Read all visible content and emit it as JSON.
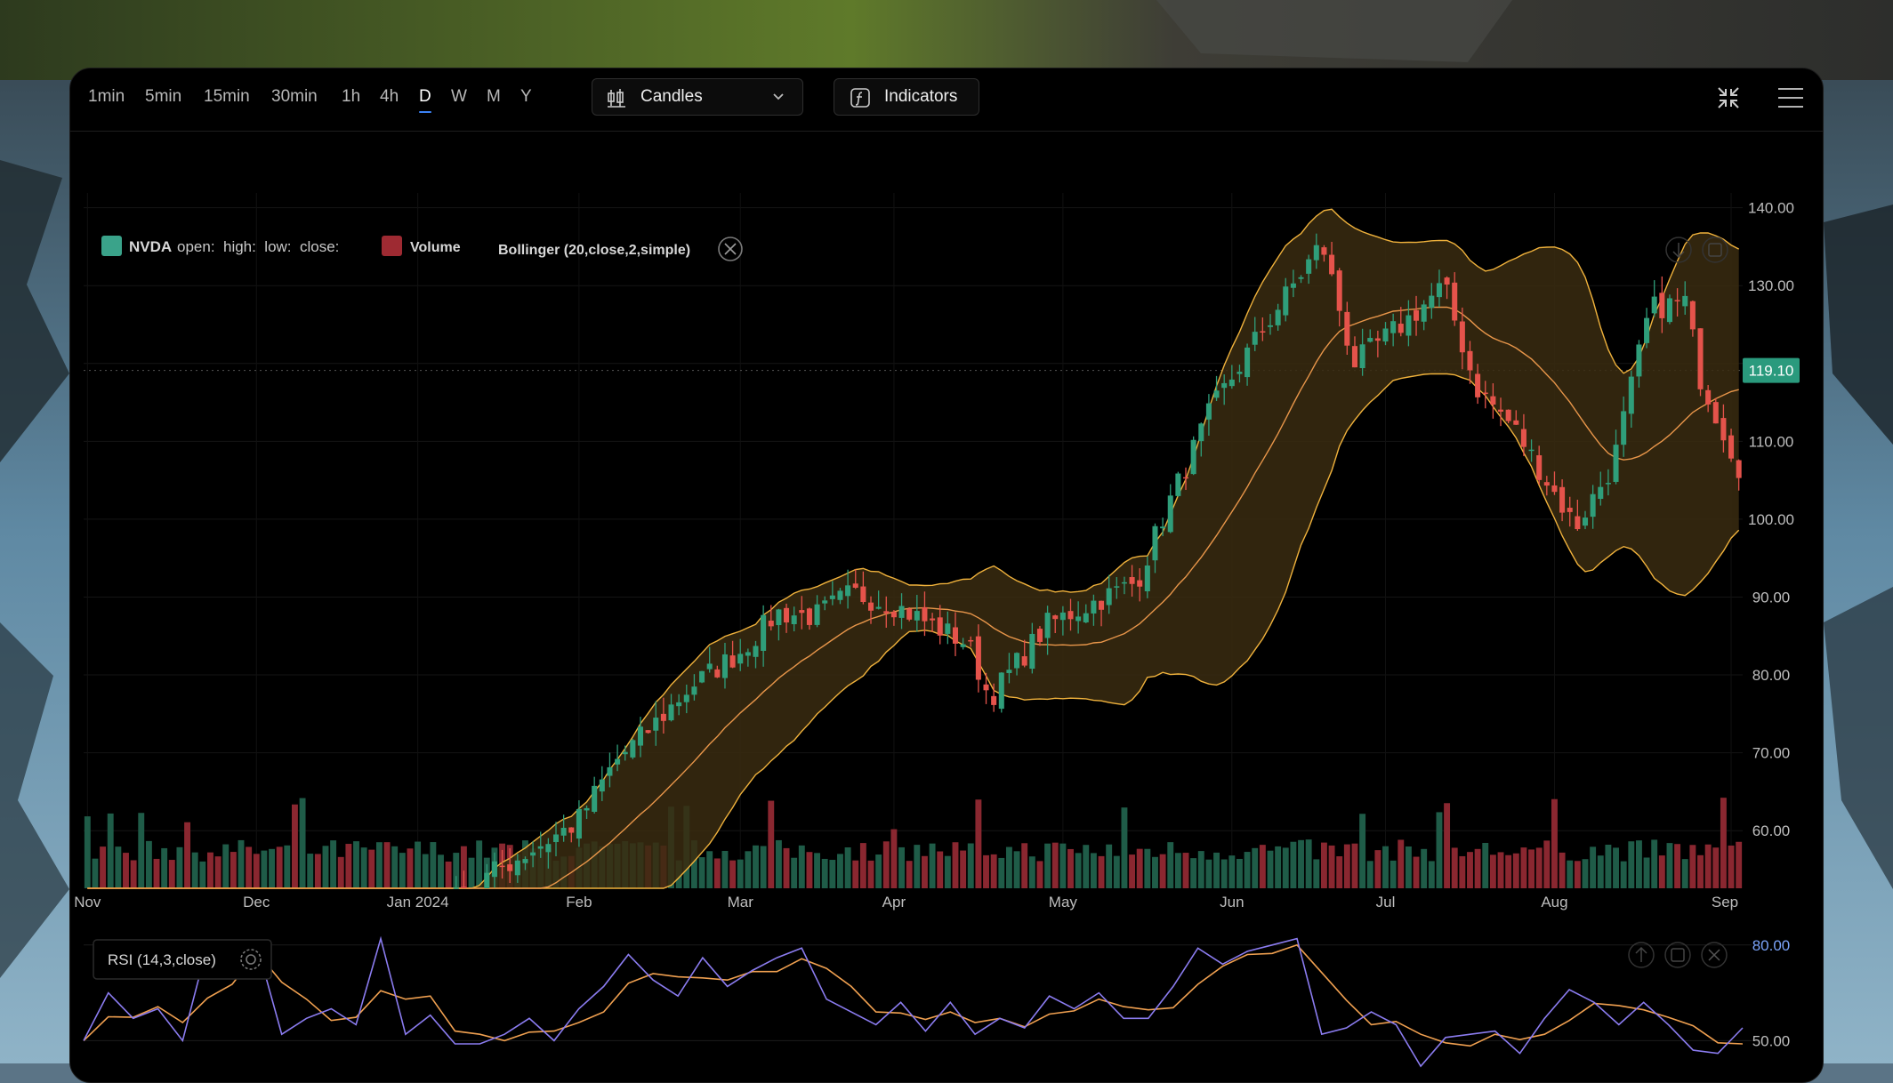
{
  "toolbar": {
    "timeframes": [
      "1min",
      "5min",
      "15min",
      "30min",
      "1h",
      "4h",
      "D",
      "W",
      "M",
      "Y"
    ],
    "active_timeframe": "D",
    "chart_type_label": "Candles",
    "indicators_label": "Indicators"
  },
  "legend": {
    "symbol": "NVDA",
    "ohlc_fields": "open:  high:  low:  close:",
    "volume_label": "Volume",
    "bollinger_label": "Bollinger (20,close,2,simple)",
    "rsi_label": "RSI (14,3,close)"
  },
  "colors": {
    "up": "#2f9e7a",
    "down": "#e5534b",
    "volume_up": "#1f5c48",
    "volume_down": "#8a2730",
    "bb_band": "#f0b23c",
    "bb_fill": "#3a2b10",
    "rsi_line": "#8b7cf0",
    "rsi_signal": "#f0a050",
    "price_tag": "#2a9a7d",
    "rsi_axis_label": "#7aa2f7"
  },
  "chart_data": [
    {
      "type": "candlestick",
      "symbol": "NVDA",
      "x_axis_labels": [
        "Nov",
        "Dec",
        "Jan 2024",
        "Feb",
        "Mar",
        "Apr",
        "May",
        "Jun",
        "Jul",
        "Aug",
        "Sep"
      ],
      "y_ticks": [
        "140.00",
        "130.00",
        "120.00",
        "110.00",
        "100.00",
        "90.00",
        "80.00",
        "70.00",
        "60.00"
      ],
      "ylim": [
        52.6,
        141.9
      ],
      "last_price": "119.10",
      "grid": true,
      "x_dates_note": "monthly anchors",
      "close_anchors": [
        {
          "t": "Jan 2024",
          "close": 48
        },
        {
          "t": "Jan 15",
          "close": 54.5
        },
        {
          "t": "Jan 31",
          "close": 61
        },
        {
          "t": "Feb 8",
          "close": 69
        },
        {
          "t": "Feb 15",
          "close": 73.5
        },
        {
          "t": "Feb 22",
          "close": 78.5
        },
        {
          "t": "Mar 1",
          "close": 83
        },
        {
          "t": "Mar 8",
          "close": 88
        },
        {
          "t": "Mar 15",
          "close": 87.5
        },
        {
          "t": "Mar 22",
          "close": 90.5
        },
        {
          "t": "Apr 1",
          "close": 89
        },
        {
          "t": "Apr 15",
          "close": 84
        },
        {
          "t": "Apr 19",
          "close": 77
        },
        {
          "t": "Apr 30",
          "close": 86.5
        },
        {
          "t": "May 15",
          "close": 92
        },
        {
          "t": "May 20",
          "close": 100.5
        },
        {
          "t": "May 29",
          "close": 114
        },
        {
          "t": "Jun 5",
          "close": 122.5
        },
        {
          "t": "Jun 18",
          "close": 135.5
        },
        {
          "t": "Jun 24",
          "close": 120
        },
        {
          "t": "Jul 5",
          "close": 125.5
        },
        {
          "t": "Jul 12",
          "close": 130
        },
        {
          "t": "Jul 18",
          "close": 117
        },
        {
          "t": "Jul 25",
          "close": 112
        },
        {
          "t": "Aug 5",
          "close": 99
        },
        {
          "t": "Aug 12",
          "close": 107
        },
        {
          "t": "Aug 19",
          "close": 127
        },
        {
          "t": "Aug 26",
          "close": 128
        },
        {
          "t": "Aug 28",
          "close": 119
        },
        {
          "t": "Sep 3",
          "close": 106
        }
      ],
      "bollinger": {
        "period": 20,
        "source": "close",
        "stddev": 2,
        "ma": "simple"
      },
      "volume": true
    },
    {
      "type": "line",
      "title": "RSI (14,3,close)",
      "y_ticks": [
        "80.00",
        "50.00"
      ],
      "ylim": [
        37,
        83
      ],
      "series": [
        {
          "values": [
            50,
            65,
            57,
            60,
            50,
            80,
            73,
            80,
            52,
            57,
            60,
            55,
            82,
            52,
            58,
            49,
            49,
            52,
            57,
            50,
            60,
            67,
            77,
            69,
            64,
            76,
            67,
            72,
            76,
            79,
            63,
            59,
            55,
            62,
            53,
            62,
            52,
            57,
            54,
            64,
            60,
            65,
            57,
            57,
            67,
            79,
            74,
            78,
            80,
            82,
            52,
            54,
            59,
            55,
            42,
            51,
            52,
            53,
            46,
            57,
            66,
            62,
            55,
            62,
            55,
            47,
            46,
            54
          ]
        }
      ]
    }
  ]
}
